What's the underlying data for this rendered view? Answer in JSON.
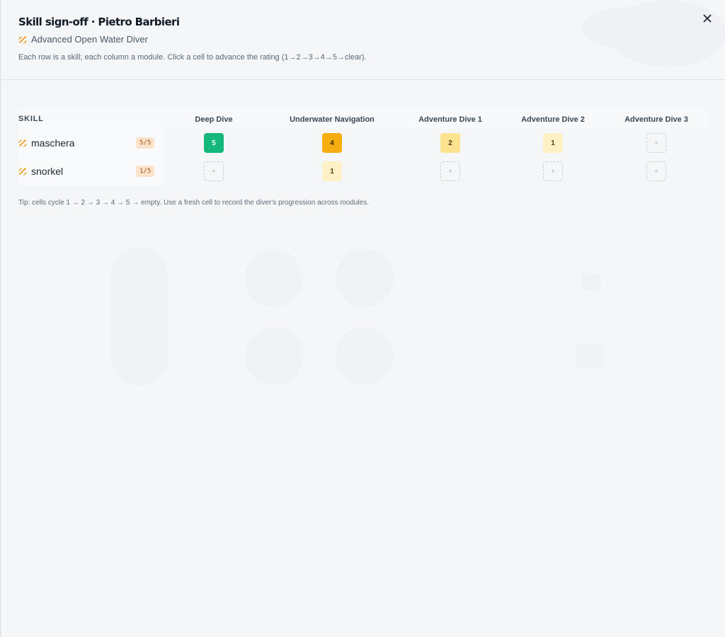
{
  "header": {
    "title": "Skill sign-off · Pietro Barbieri",
    "course": "Advanced Open Water Diver",
    "description": "Each row is a skill; each column a module. Click a cell to advance the rating (1→2→3→4→5→clear).",
    "close_glyph": "×"
  },
  "grid": {
    "skill_header": "SKILL",
    "modules": [
      "Deep Dive",
      "Underwater Navigation",
      "Adventure Dive 1",
      "Adventure Dive 2",
      "Adventure Dive 3"
    ],
    "rows": [
      {
        "skill": "maschera",
        "score": "5/5",
        "cells": [
          "5",
          "4",
          "2",
          "1",
          ""
        ]
      },
      {
        "skill": "snorkel",
        "score": "1/5",
        "cells": [
          "",
          "1",
          "",
          "",
          ""
        ]
      }
    ],
    "empty_glyph": "+"
  },
  "tip": "Tip: cells cycle 1 → 2 → 3 → 4 → 5 → empty. Use a fresh cell to record the diver's progression across modules.",
  "colors": {
    "level5": "#16b77a",
    "level4": "#f5ad0f",
    "level2": "#fde38f",
    "level1": "#fef1c8",
    "accent_spark": "#f29a1a",
    "score_badge_bg": "#fce4cc"
  },
  "icons": {
    "skill": "sparkle-icon",
    "close": "close-icon"
  }
}
